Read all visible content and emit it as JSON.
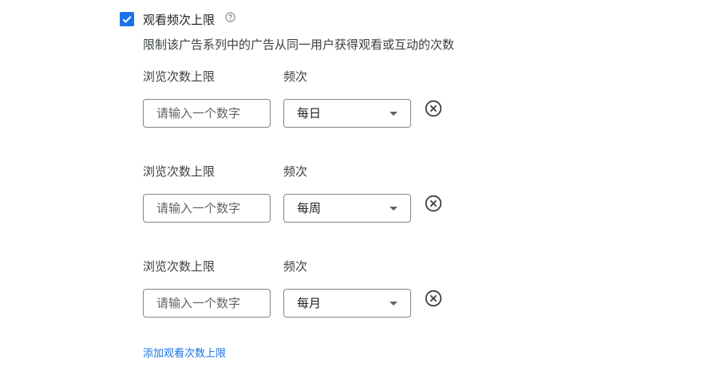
{
  "section": {
    "title": "观看频次上限",
    "checked": true,
    "description": "限制该广告系列中的广告从同一用户获得观看或互动的次数",
    "help_icon": "help-circle-icon"
  },
  "caps": [
    {
      "views_label": "浏览次数上限",
      "views_placeholder": "请输入一个数字",
      "frequency_label": "频次",
      "frequency_value": "每日"
    },
    {
      "views_label": "浏览次数上限",
      "views_placeholder": "请输入一个数字",
      "frequency_label": "频次",
      "frequency_value": "每周"
    },
    {
      "views_label": "浏览次数上限",
      "views_placeholder": "请输入一个数字",
      "frequency_label": "频次",
      "frequency_value": "每月"
    }
  ],
  "add_link": "添加观看次数上限",
  "colors": {
    "accent": "#1a73e8",
    "border": "#80868b",
    "text": "#202124",
    "muted": "#3c4043"
  }
}
